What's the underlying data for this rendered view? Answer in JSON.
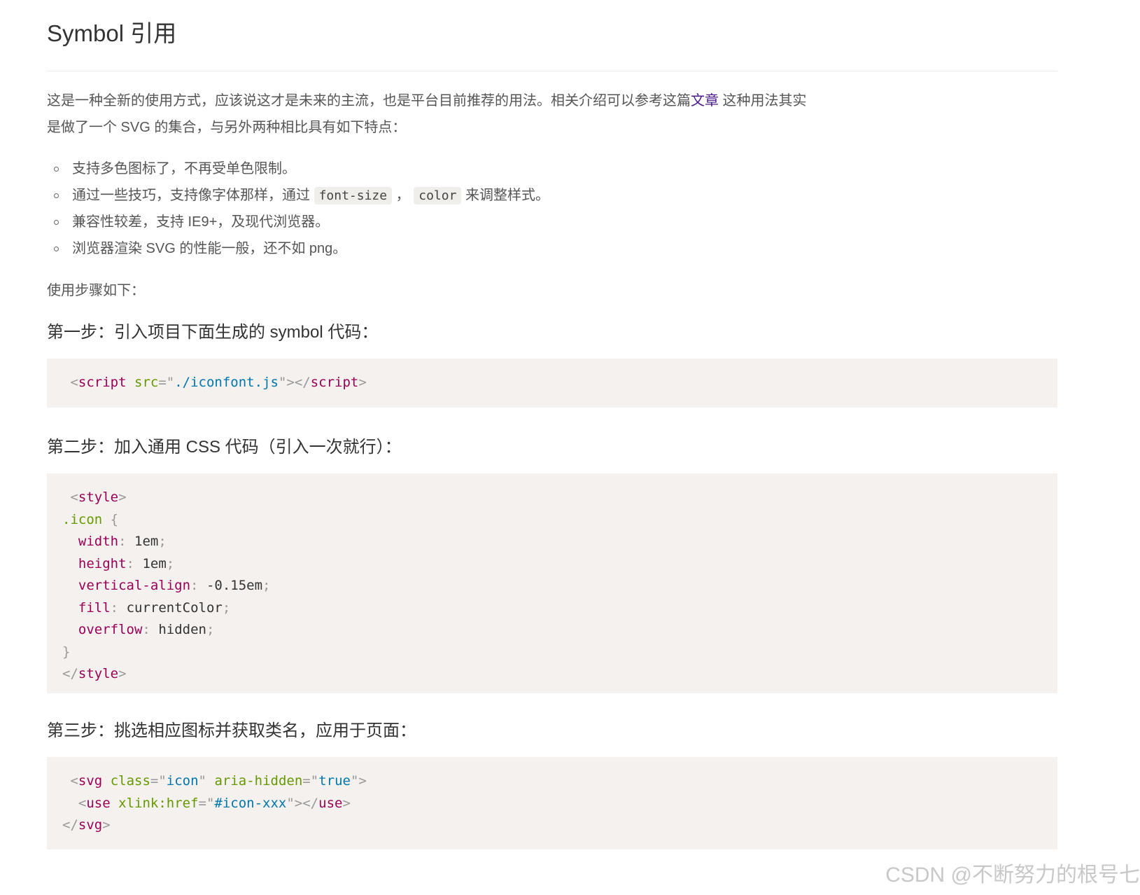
{
  "title": "Symbol 引用",
  "intro": {
    "before_link": "这是一种全新的使用方式，应该说这才是未来的主流，也是平台目前推荐的用法。相关介绍可以参考这篇",
    "link_text": "文章",
    "after_link_line1": " 这种用法其实",
    "line2": "是做了一个 SVG 的集合，与另外两种相比具有如下特点："
  },
  "features": [
    {
      "text": "支持多色图标了，不再受单色限制。"
    },
    {
      "before": "通过一些技巧，支持像字体那样，通过 ",
      "code1": "font-size",
      "sep": " ，",
      "code2": "color",
      "after": " 来调整样式。"
    },
    {
      "text": "兼容性较差，支持 IE9+，及现代浏览器。"
    },
    {
      "text": "浏览器渲染 SVG 的性能一般，还不如 png。"
    }
  ],
  "usage_label": "使用步骤如下：",
  "steps": [
    {
      "heading": "第一步：引入项目下面生成的 symbol 代码："
    },
    {
      "heading": "第二步：加入通用 CSS 代码（引入一次就行）："
    },
    {
      "heading": "第三步：挑选相应图标并获取类名，应用于页面："
    }
  ],
  "code1": {
    "tag": "script",
    "attr": "src",
    "value": "./iconfont.js"
  },
  "code2": {
    "style_tag": "style",
    "selector": ".icon",
    "props": [
      {
        "name": "width",
        "value": "1em"
      },
      {
        "name": "height",
        "value": "1em"
      },
      {
        "name": "vertical-align",
        "value": "-0.15em"
      },
      {
        "name": "fill",
        "value": "currentColor"
      },
      {
        "name": "overflow",
        "value": "hidden"
      }
    ]
  },
  "code3": {
    "svg_tag": "svg",
    "class_attr": "class",
    "class_val": "icon",
    "aria_attr": "aria-hidden",
    "aria_val": "true",
    "use_tag": "use",
    "href_attr": "xlink:href",
    "href_val": "#icon-xxx"
  },
  "watermark": "CSDN @不断努力的根号七"
}
